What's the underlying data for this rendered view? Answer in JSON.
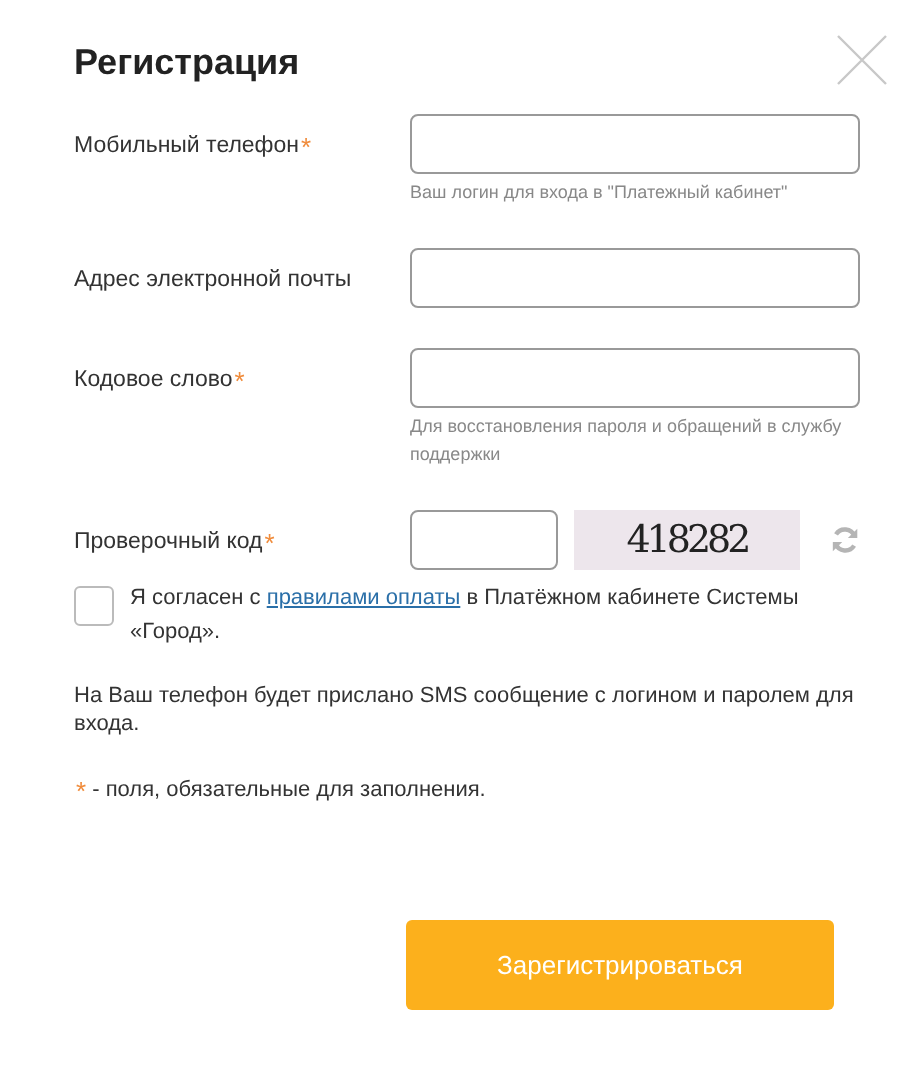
{
  "title": "Регистрация",
  "required_mark": "*",
  "fields": [
    {
      "kind": "text",
      "label": "Мобильный телефон",
      "required": true,
      "hint": "Ваш логин для входа в \"Платежный кабинет\""
    },
    {
      "kind": "text",
      "label": "Адрес электронной почты",
      "required": false
    },
    {
      "kind": "text",
      "label": "Кодовое слово",
      "required": true,
      "hint": "Для восстановления пароля и обращений в службу поддержки"
    },
    {
      "kind": "captcha",
      "label": "Проверочный код",
      "required": true,
      "captcha_text": "418282"
    }
  ],
  "agreement": {
    "checked": false,
    "before": "Я согласен с ",
    "link": "правилами оплаты",
    "after": " в Платёжном кабинете Системы «Город»."
  },
  "sms_note": "На Ваш телефон будет прислано SMS сообщение с логином и паролем для входа.",
  "required_note": {
    "mark": "*",
    "text": "- поля, обязательные для заполнения."
  },
  "submit": "Зарегистрироваться"
}
